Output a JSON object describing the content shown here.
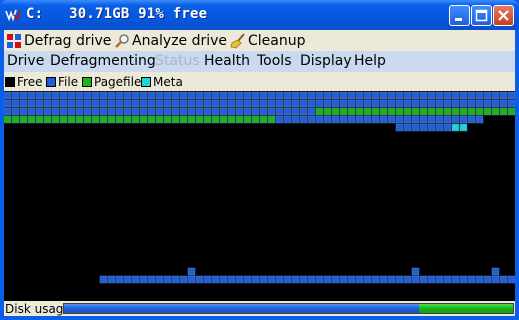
{
  "window": {
    "title": "C:   30.71GB 91% free",
    "icon": "vmware-style-logo-icon"
  },
  "toolbar": {
    "defrag_label": "Defrag drive",
    "analyze_label": "Analyze drive",
    "cleanup_label": "Cleanup"
  },
  "menu": {
    "items": [
      "Drive",
      "Defragmenting",
      "Status",
      "Health",
      "Tools",
      "Display",
      "Help"
    ],
    "disabled": [
      "Status"
    ]
  },
  "legend": {
    "items": [
      {
        "label": "Free",
        "color": "#000000"
      },
      {
        "label": "File",
        "color": "#1F5FDC"
      },
      {
        "label": "Pagefile",
        "color": "#18B418"
      },
      {
        "label": "Meta",
        "color": "#18D8D8"
      }
    ]
  },
  "colors": {
    "free": "#000000",
    "file": "#1F5FDC",
    "pagefile": "#18B418",
    "meta": "#18D8D8",
    "grid": "#5A78A8"
  },
  "disk_map": {
    "rows": 24,
    "cols": 64,
    "row_segments": [
      {
        "row": 0,
        "segments": [
          [
            "file",
            0,
            63
          ]
        ]
      },
      {
        "row": 1,
        "segments": [
          [
            "file",
            0,
            63
          ]
        ]
      },
      {
        "row": 2,
        "segments": [
          [
            "file",
            0,
            38
          ],
          [
            "pagefile",
            39,
            63
          ]
        ]
      },
      {
        "row": 3,
        "segments": [
          [
            "pagefile",
            0,
            33
          ],
          [
            "file",
            34,
            59
          ],
          [
            "free",
            60,
            63
          ]
        ]
      },
      {
        "row": 4,
        "segments": [
          [
            "free",
            0,
            48
          ],
          [
            "file",
            49,
            55
          ],
          [
            "meta",
            56,
            57
          ],
          [
            "free",
            58,
            63
          ]
        ]
      },
      {
        "row": 23,
        "segments": [
          [
            "free",
            0,
            11
          ],
          [
            "file",
            12,
            63
          ]
        ]
      }
    ],
    "extra_cells": [
      {
        "row": 22,
        "col": 23,
        "type": "file"
      },
      {
        "row": 22,
        "col": 51,
        "type": "file"
      },
      {
        "row": 22,
        "col": 61,
        "type": "file"
      }
    ]
  },
  "status": {
    "label": "Disk usage",
    "file_fraction": 0.79,
    "pagefile_fraction": 0.21
  }
}
